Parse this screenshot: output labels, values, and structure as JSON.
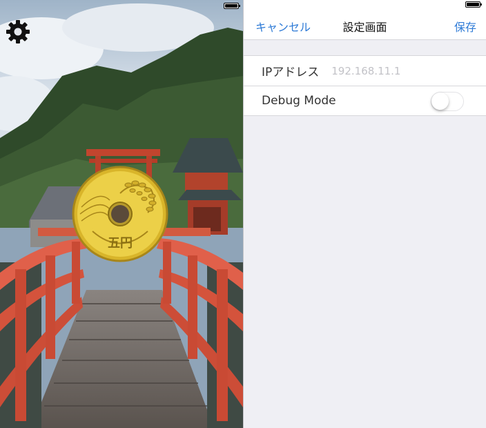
{
  "left_screen": {
    "settings_icon": "gear-icon",
    "coin": {
      "icon": "five-yen-coin",
      "label": "五円",
      "color": "#e8c93a"
    }
  },
  "settings": {
    "nav": {
      "cancel": "キャンセル",
      "title": "設定画面",
      "save": "保存"
    },
    "rows": {
      "ip_label": "IPアドレス",
      "ip_placeholder": "192.168.11.1",
      "debug_label": "Debug Mode",
      "debug_mode_on": false
    }
  },
  "colors": {
    "accent": "#2d7ad6",
    "background": "#efeff4"
  }
}
